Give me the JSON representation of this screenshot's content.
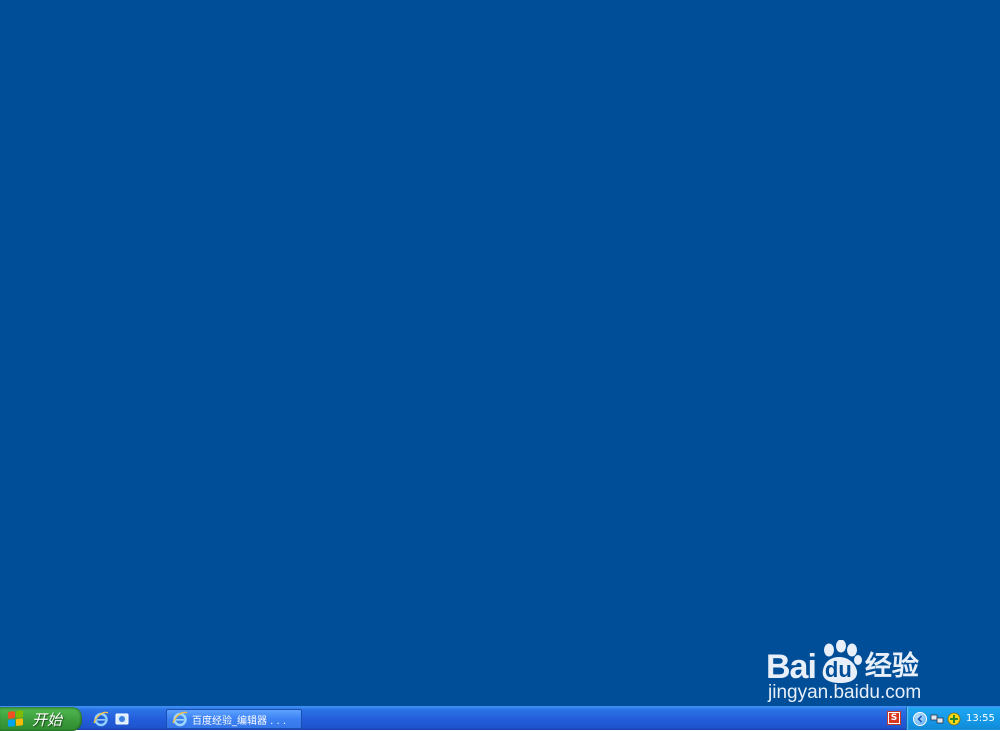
{
  "desktop": {
    "background_color": "#004e98"
  },
  "watermark": {
    "brand_part1": "Bai",
    "brand_part2": "du",
    "brand_cn": "经验",
    "url": "jingyan.baidu.com"
  },
  "taskbar": {
    "start_label": "开始",
    "quicklaunch": [
      {
        "icon": "internet-explorer-icon"
      },
      {
        "icon": "show-desktop-icon"
      }
    ],
    "tasks": [
      {
        "label": "百度经验_编辑器  . . .",
        "icon": "internet-explorer-icon"
      }
    ],
    "ime": {
      "label": "S",
      "color": "#d8361e"
    },
    "tray": {
      "icons": [
        "show-hidden-icons-chevron",
        "network-icon",
        "security-shield-icon"
      ],
      "clock": "13:55"
    }
  }
}
